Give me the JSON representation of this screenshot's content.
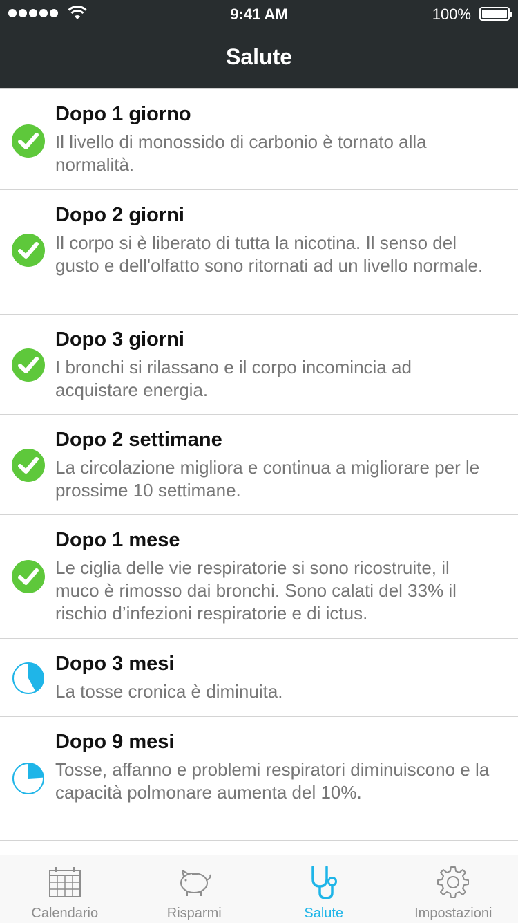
{
  "status_bar": {
    "time": "9:41 AM",
    "battery": "100%"
  },
  "nav": {
    "title": "Salute"
  },
  "colors": {
    "accent": "#1fb5e8",
    "done_green": "#5ec83b",
    "header_bg": "#282d2f"
  },
  "milestones": [
    {
      "title": "Dopo 1 giorno",
      "description": "Il livello di monossido di carbonio è tornato alla normalità.",
      "state": "completed",
      "icon": "check-circle-icon"
    },
    {
      "title": "Dopo 2 giorni",
      "description": "Il corpo si è liberato di tutta la nicotina. Il senso del gusto e dell'olfatto sono ritornati ad un livello normale.",
      "state": "completed",
      "icon": "check-circle-icon"
    },
    {
      "title": "Dopo 3 giorni",
      "description": "I bronchi si rilassano e il corpo incomincia ad acquistare energia.",
      "state": "completed",
      "icon": "check-circle-icon"
    },
    {
      "title": "Dopo 2 settimane",
      "description": "La circolazione migliora e continua a migliorare per le prossime 10 settimane.",
      "state": "completed",
      "icon": "check-circle-icon"
    },
    {
      "title": "Dopo 1 mese",
      "description": "Le ciglia delle vie respiratorie si sono ricostruite, il muco è rimosso dai bronchi. Sono calati del 33% il rischio d’infezioni respiratorie e di ictus.",
      "state": "completed",
      "icon": "check-circle-icon"
    },
    {
      "title": "Dopo 3 mesi",
      "description": "La tosse cronica è diminuita.",
      "state": "in-progress",
      "progress": 0.42,
      "icon": "progress-pie-icon"
    },
    {
      "title": "Dopo 9 mesi",
      "description": "Tosse, affanno e problemi respiratori diminuiscono e la capacità polmonare aumenta del 10%.",
      "state": "in-progress",
      "progress": 0.24,
      "icon": "progress-pie-icon"
    }
  ],
  "tabs": [
    {
      "label": "Calendario",
      "icon": "calendar-icon",
      "active": false
    },
    {
      "label": "Risparmi",
      "icon": "piggy-bank-icon",
      "active": false
    },
    {
      "label": "Salute",
      "icon": "stethoscope-icon",
      "active": true
    },
    {
      "label": "Impostazioni",
      "icon": "gear-icon",
      "active": false
    }
  ]
}
